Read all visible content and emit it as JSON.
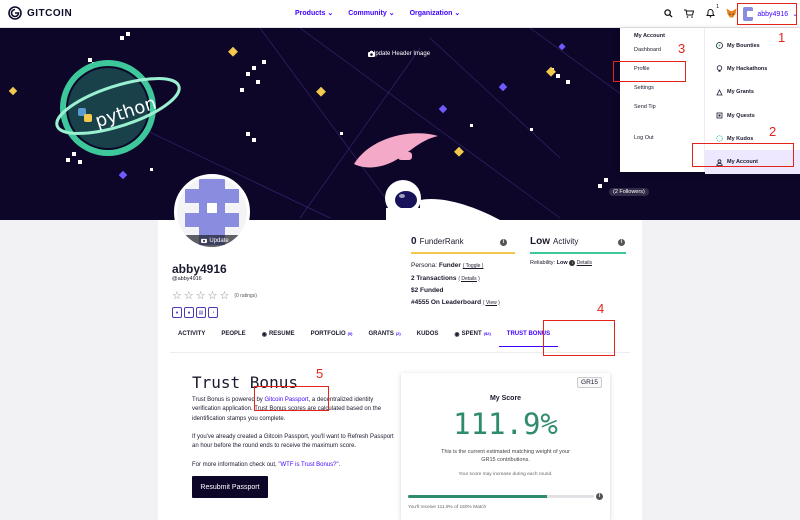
{
  "nav": {
    "logo": "GITCOIN",
    "links": [
      "Products",
      "Community",
      "Organization"
    ],
    "bell_count": "1",
    "username": "abby4916"
  },
  "banner": {
    "update_header": "Update Header Image",
    "followers": "(2 Followers)",
    "sticker_text": "python"
  },
  "dropdown": {
    "heading": "My Account",
    "left_items": [
      "Dashboard",
      "Profile",
      "Settings",
      "Send Tip",
      "Log Out"
    ],
    "right_items": [
      "My Bounties",
      "My Hackathons",
      "My Grants",
      "My Quests",
      "My Kudos",
      "My Account"
    ]
  },
  "profile": {
    "avatar_update": "Update",
    "handle": "abby4916",
    "handle_at": "@abby4916",
    "ratings": "(0 ratings)",
    "star_count": 0,
    "funder": {
      "rank_value": "0",
      "rank_label": "FunderRank",
      "persona_label": "Persona:",
      "persona_value": "Funder",
      "toggle": "( Toggle )",
      "transactions": "2 Transactions",
      "details": "( Details )",
      "funded": "$2 Funded",
      "leaderboard": "#4555 On Leaderboard",
      "view": "( View )"
    },
    "activity": {
      "level": "Low",
      "label": "Activity",
      "reliability_label": "Reliability:",
      "reliability_value": "Low",
      "details": "Details"
    }
  },
  "tabs": [
    {
      "label": "ACTIVITY",
      "count": ""
    },
    {
      "label": "PEOPLE",
      "count": ""
    },
    {
      "label": "RESUME",
      "count": ""
    },
    {
      "label": "PORTFOLIO",
      "count": "(0)"
    },
    {
      "label": "GRANTS",
      "count": "(2)"
    },
    {
      "label": "KUDOS",
      "count": ""
    },
    {
      "label": "SPENT",
      "count": "($2)"
    },
    {
      "label": "TRUST BONUS",
      "count": ""
    }
  ],
  "trust_bonus": {
    "title": "Trust Bonus",
    "p1_pre": "Trust Bonus is powered by ",
    "p1_link": "Gitcoin Passport",
    "p1_post": ", a decentralized identity verification application. Trust Bonus scores are calculated based on the identification stamps you complete.",
    "p2": "If you've already created a Gitcoin Passport, you'll want to Refresh Passport an hour before the round ends to receive the maximum score.",
    "p3_pre": "For more information check out, ",
    "p3_link": "\"WTF is Trust Bonus?\"",
    "p3_post": ".",
    "button": "Resubmit Passport"
  },
  "score": {
    "round": "GR15",
    "label": "My Score",
    "value": "111.9%",
    "sub": "This is the current estimated matching weight of your GR15 contributions.",
    "note": "Your score may increase during each round.",
    "progress": 0.746,
    "bar_text": "You'll receive 111.9% of 150% Match"
  },
  "annotations": [
    "1",
    "2",
    "3",
    "4",
    "5"
  ],
  "colors": {
    "brand": "#3e00ff",
    "banner_bg": "#0d0629",
    "score_green": "#2e8b6b",
    "annotation_red": "#e3241a"
  }
}
